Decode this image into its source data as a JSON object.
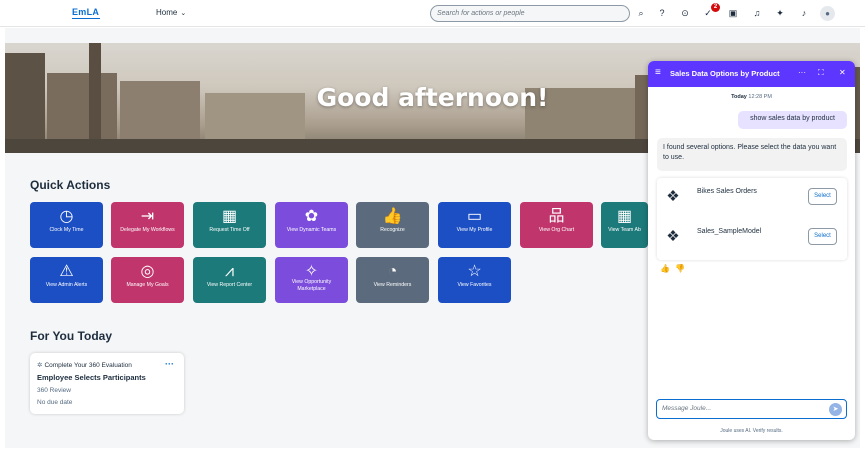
{
  "shell": {
    "logo": "EmLA",
    "home_label": "Home",
    "search_placeholder": "Search for actions or people",
    "notification_badge": "2",
    "icons": [
      "search-icon",
      "help-icon",
      "location-icon",
      "approvals-icon",
      "chat-icon",
      "headset-icon",
      "joule-icon",
      "bell-icon",
      "avatar-icon"
    ]
  },
  "hero": {
    "greeting": "Good afternoon!"
  },
  "quick_actions": {
    "title": "Quick Actions",
    "tiles": [
      {
        "label": "Clock My Time",
        "icon": "clock-icon",
        "glyph": "◷",
        "color": "#1c4fc4"
      },
      {
        "label": "Delegate My Workflows",
        "icon": "delegate-icon",
        "glyph": "⇥",
        "color": "#c1356d"
      },
      {
        "label": "Request Time Off",
        "icon": "calendar-icon",
        "glyph": "▦",
        "color": "#1d7a7a"
      },
      {
        "label": "View Dynamic Teams",
        "icon": "teams-icon",
        "glyph": "✿",
        "color": "#7c4ddc"
      },
      {
        "label": "Recognize",
        "icon": "thumbs-up-icon",
        "glyph": "👍",
        "color": "#5b6b7d"
      },
      {
        "label": "View My Profile",
        "icon": "profile-card-icon",
        "glyph": "▭",
        "color": "#1c4fc4"
      },
      {
        "label": "View Org Chart",
        "icon": "org-chart-icon",
        "glyph": "品",
        "color": "#c1356d"
      },
      {
        "label": "View Team Ab",
        "icon": "calendar-icon",
        "glyph": "▦",
        "color": "#1d7a7a"
      },
      {
        "label": "View Admin Alerts",
        "icon": "alert-icon",
        "glyph": "⚠",
        "color": "#1c4fc4"
      },
      {
        "label": "Manage My Goals",
        "icon": "target-icon",
        "glyph": "◎",
        "color": "#c1356d"
      },
      {
        "label": "View Report Center",
        "icon": "chart-icon",
        "glyph": "⩘",
        "color": "#1d7a7a"
      },
      {
        "label": "View Opportunity Marketplace",
        "icon": "marketplace-icon",
        "glyph": "✧",
        "color": "#7c4ddc"
      },
      {
        "label": "View Reminders",
        "icon": "reminder-icon",
        "glyph": "◔",
        "color": "#5b6b7d"
      },
      {
        "label": "View Favorites",
        "icon": "star-icon",
        "glyph": "☆",
        "color": "#1c4fc4"
      }
    ]
  },
  "for_you": {
    "title": "For You Today",
    "card": {
      "type_label": "Complete Your 360 Evaluation",
      "title": "Employee Selects Participants",
      "subtitle": "360 Review",
      "due": "No due date",
      "more": "···"
    }
  },
  "joule": {
    "title": "Sales Data Options by Product",
    "day": "Today",
    "time": "12:28 PM",
    "user_message": "show sales data by product",
    "bot_message": "I found several options. Please select the data you want to use.",
    "options": [
      {
        "name": "Bikes Sales Orders",
        "select": "Select"
      },
      {
        "name": "Sales_SampleModel",
        "select": "Select"
      }
    ],
    "input_placeholder": "Message Joule...",
    "footer": "Joule uses AI. Verify results."
  }
}
